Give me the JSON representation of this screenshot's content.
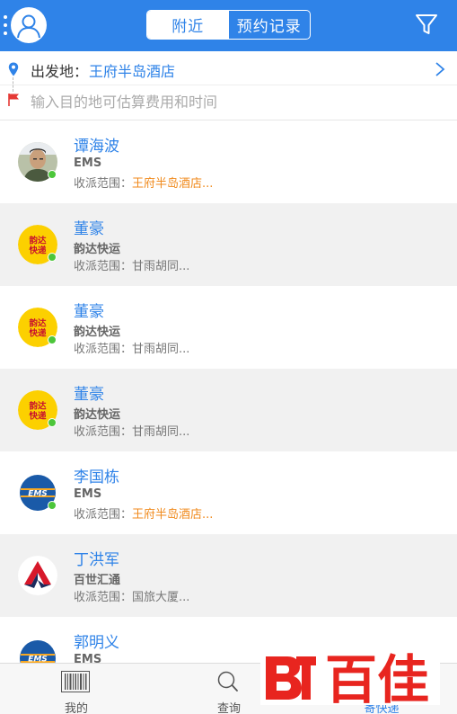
{
  "header": {
    "tabs": [
      {
        "label": "附近",
        "active": true
      },
      {
        "label": "预约记录",
        "active": false
      }
    ],
    "accent_color": "#2f83e8"
  },
  "route": {
    "from_label": "出发地：",
    "from_value": "王府半岛酒店",
    "to_placeholder": "输入目的地可估算费用和时间"
  },
  "couriers": [
    {
      "name": "谭海波",
      "company": "EMS",
      "range_label": "收派范围：",
      "range": "王府半岛酒店...",
      "range_color": "orange",
      "logo": "person-photo",
      "online": true
    },
    {
      "name": "董豪",
      "company": "韵达快运",
      "range_label": "收派范围：",
      "range": "甘雨胡同...",
      "range_color": "gray",
      "logo": "yunda-logo",
      "online": true
    },
    {
      "name": "董豪",
      "company": "韵达快运",
      "range_label": "收派范围：",
      "range": "甘雨胡同...",
      "range_color": "gray",
      "logo": "yunda-logo",
      "online": true
    },
    {
      "name": "董豪",
      "company": "韵达快运",
      "range_label": "收派范围：",
      "range": "甘雨胡同...",
      "range_color": "gray",
      "logo": "yunda-logo",
      "online": true
    },
    {
      "name": "李国栋",
      "company": "EMS",
      "range_label": "收派范围：",
      "range": "王府半岛酒店...",
      "range_color": "orange",
      "logo": "ems-logo",
      "online": true
    },
    {
      "name": "丁洪军",
      "company": "百世汇通",
      "range_label": "收派范围：",
      "range": "国旅大厦...",
      "range_color": "gray",
      "logo": "huitong-logo",
      "online": false
    },
    {
      "name": "郭明义",
      "company": "EMS",
      "range_label": "",
      "range": "",
      "range_color": "gray",
      "logo": "ems-logo",
      "online": false
    }
  ],
  "bottom_nav": [
    {
      "label": "我的",
      "icon": "barcode-icon",
      "active": false
    },
    {
      "label": "查询",
      "icon": "search-icon",
      "active": false
    },
    {
      "label": "寄快递",
      "icon": "send-icon",
      "active": true
    }
  ],
  "watermark": {
    "text": "百佳",
    "color": "#e8251f"
  }
}
